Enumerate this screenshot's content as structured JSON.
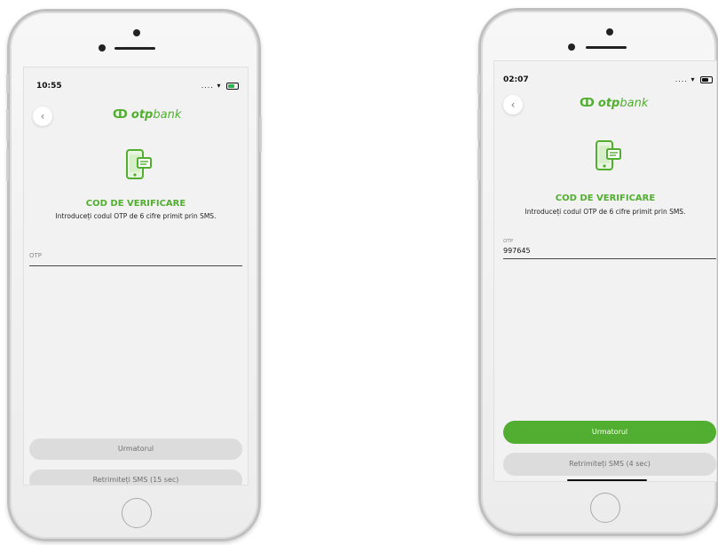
{
  "brand": {
    "logo_mark": "ↀ",
    "logo_otp": "otp",
    "logo_bank": "bank",
    "color": "#52ae30"
  },
  "screens": [
    {
      "status_time": "10:55",
      "status_icons": "....  ",
      "back_icon": "‹",
      "title": "COD DE VERIFICARE",
      "subtitle": "Introduceți codul OTP de 6 cifre primit prin SMS.",
      "otp_label": "OTP",
      "otp_value": "",
      "next_label": "Urmatorul",
      "resend_label": "Retrimiteți SMS (15 sec)",
      "next_enabled": false
    },
    {
      "status_time": "02:07",
      "status_icons": "....  ",
      "back_icon": "‹",
      "title": "COD DE VERIFICARE",
      "subtitle": "Introduceți codul OTP de 6 cifre primit prin SMS.",
      "otp_label": "OTP",
      "otp_value": "997645",
      "next_label": "Urmatorul",
      "resend_label": "Retrimiteți SMS (4 sec)",
      "next_enabled": true
    }
  ],
  "icons": {
    "wifi": "wifi-icon",
    "battery": "battery-icon",
    "back": "chevron-left-icon",
    "verify": "phone-message-icon",
    "home": "home-button-icon"
  }
}
